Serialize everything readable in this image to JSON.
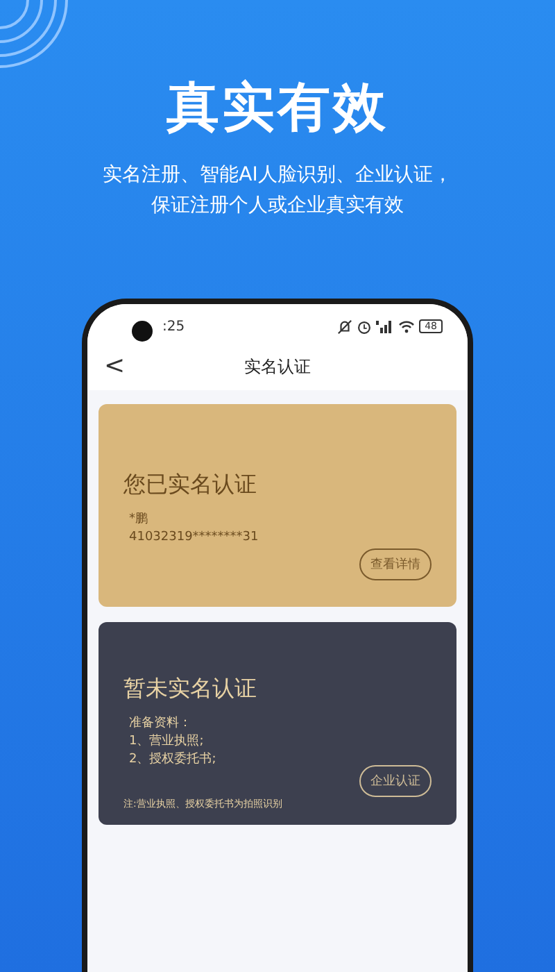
{
  "headline": "真实有效",
  "subtitle_lines": [
    "实名注册、智能AI人脸识别、企业认证，",
    "保证注册个人或企业真实有效"
  ],
  "phone": {
    "status_bar": {
      "time": ":25",
      "battery": "48"
    },
    "nav": {
      "back": "<",
      "title": "实名认证"
    },
    "cards": [
      {
        "kind": "verified",
        "title": "您已实名认证",
        "lines": [
          "*鹏",
          "41032319********31"
        ],
        "button": "查看详情"
      },
      {
        "kind": "unverified",
        "title": "暂未实名认证",
        "lines": [
          "准备资料：",
          "1、营业执照;",
          "2、授权委托书;"
        ],
        "button": "企业认证",
        "note": "注:营业执照、授权委托书为拍照识别"
      }
    ]
  }
}
